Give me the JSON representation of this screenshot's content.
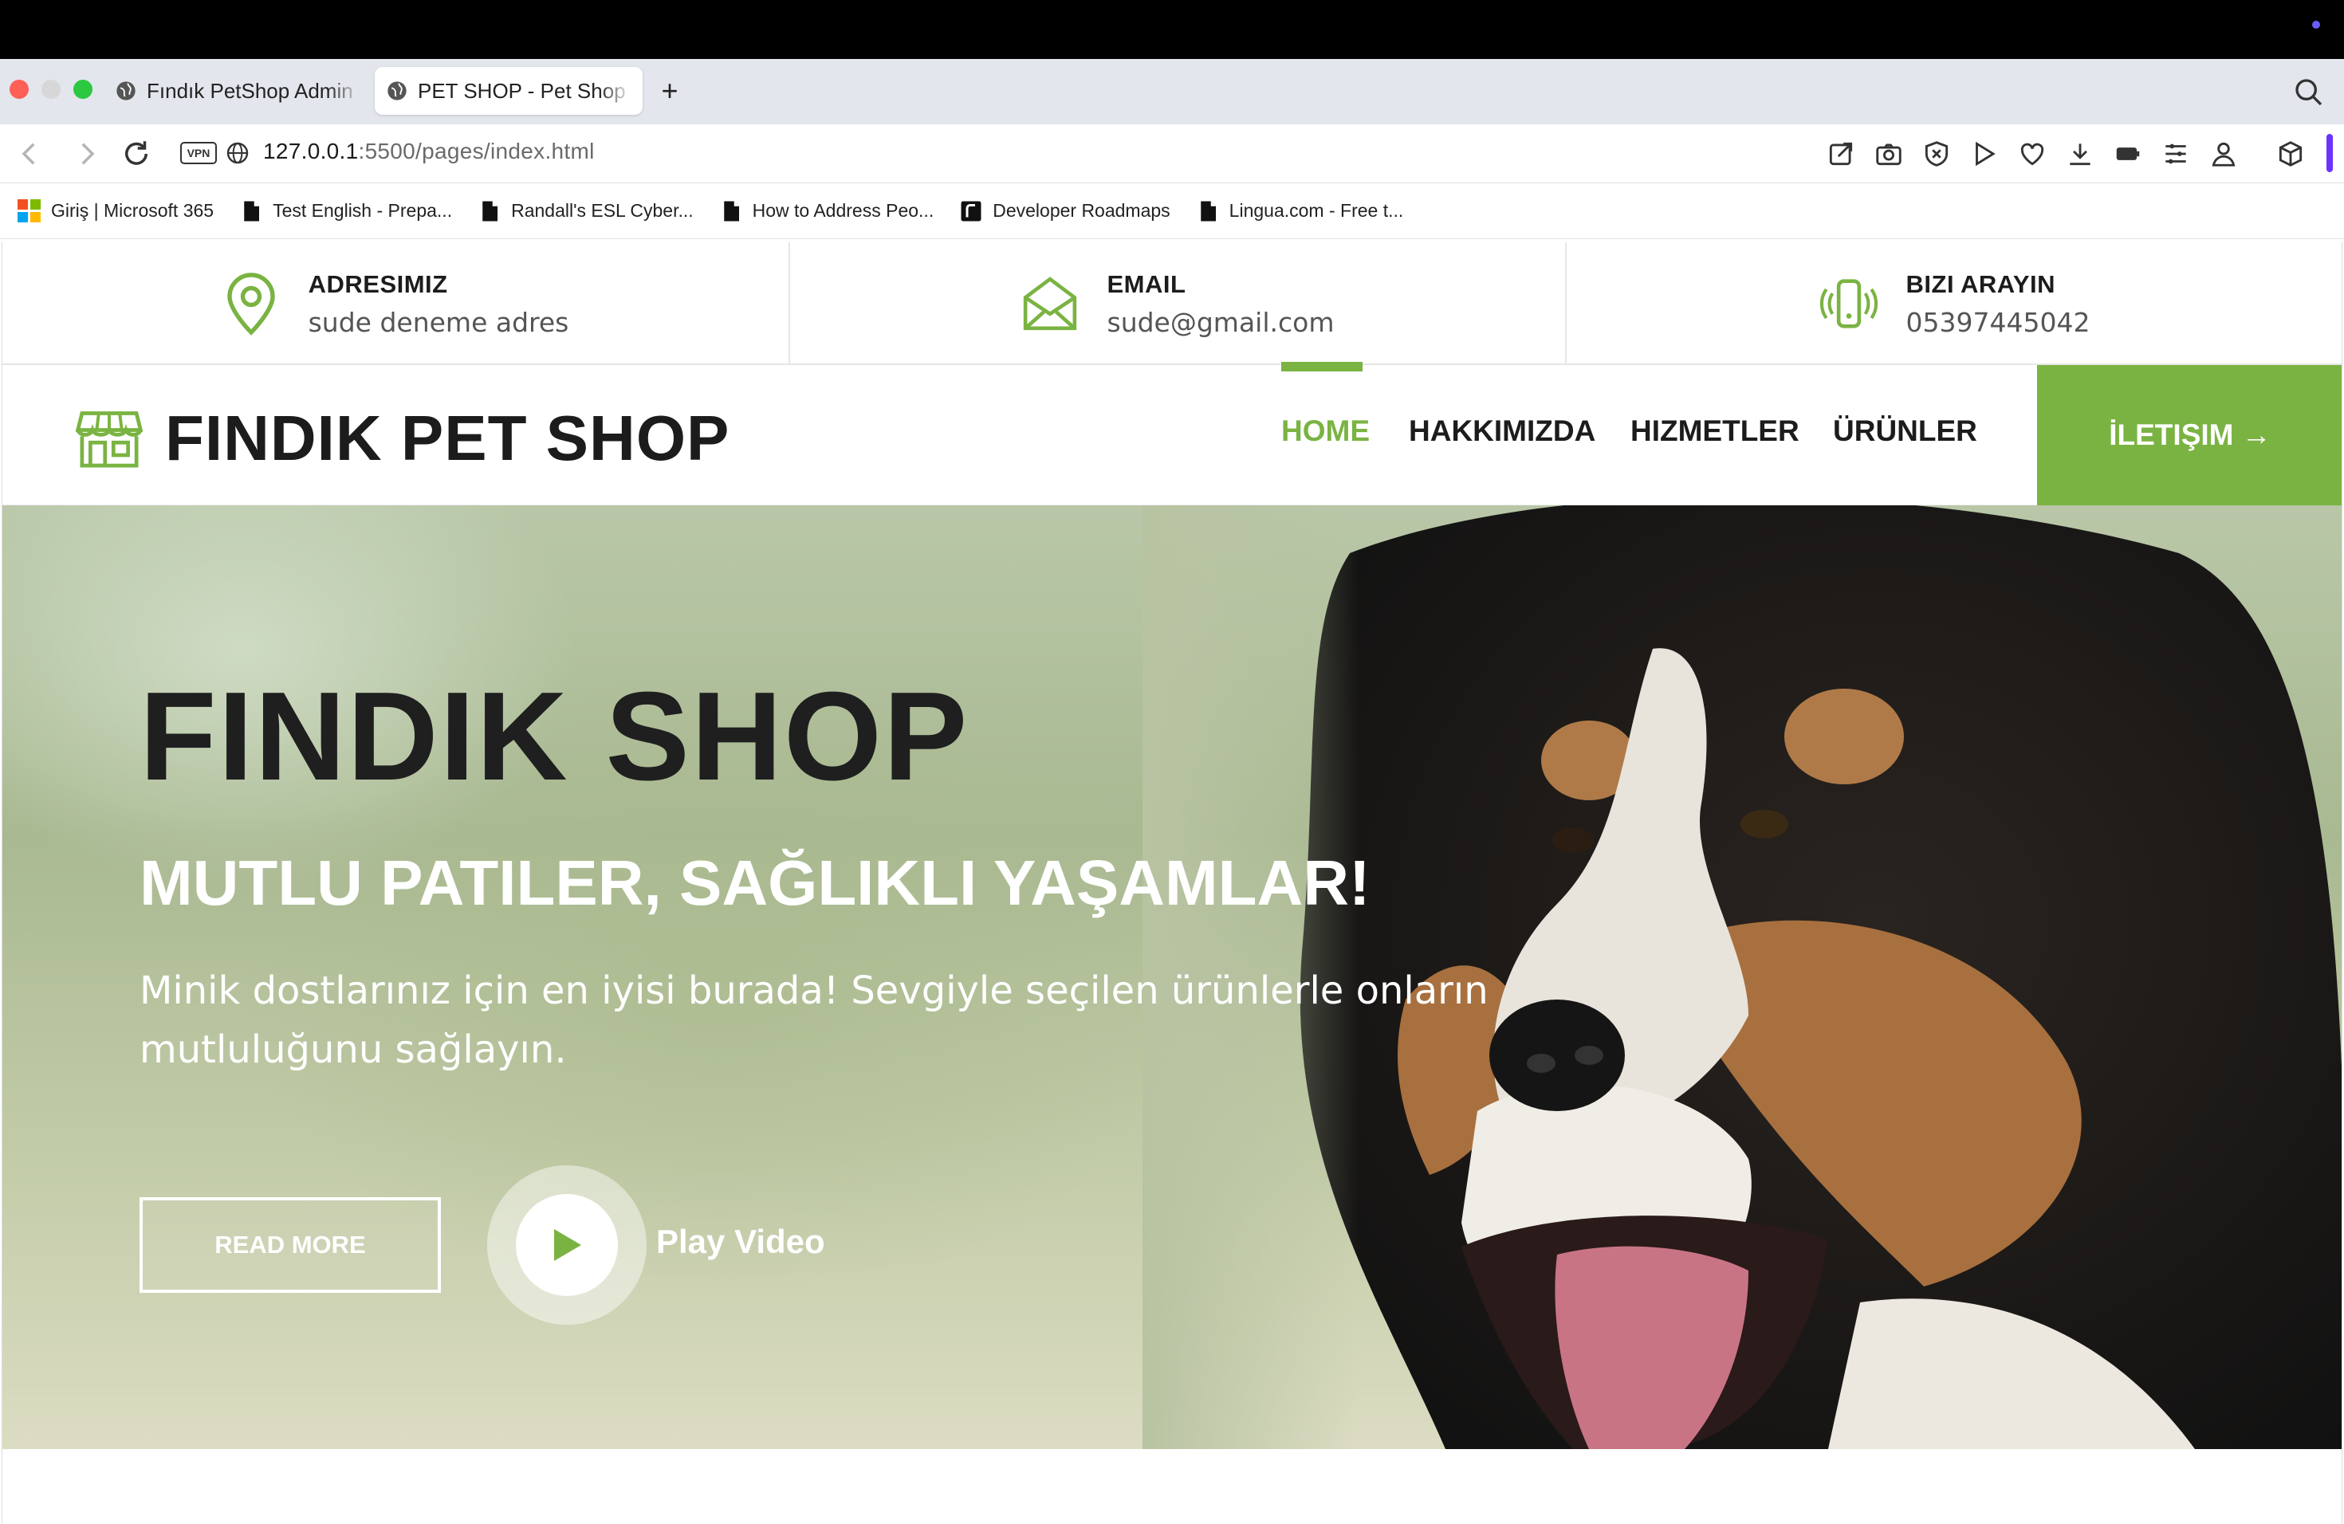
{
  "browser": {
    "tabs": [
      {
        "label": "Fındık PetShop Admin Pa",
        "active": false
      },
      {
        "label": "PET SHOP - Pet Shop W",
        "active": true
      }
    ],
    "new_tab_symbol": "+",
    "url_host": "127.0.0.1",
    "url_rest": ":5500/pages/index.html",
    "vpn_label": "VPN",
    "toolbar_icons": [
      "share-icon",
      "camera-icon",
      "shield-icon",
      "play-icon",
      "heart-icon",
      "download-icon",
      "battery-icon",
      "menu-icon",
      "profile-icon",
      "extensions-icon"
    ],
    "bookmarks": [
      {
        "label": "Giriş | Microsoft 365",
        "icon": "microsoft-icon"
      },
      {
        "label": "Test English - Prepa...",
        "icon": "document-icon"
      },
      {
        "label": "Randall's ESL Cyber...",
        "icon": "document-icon"
      },
      {
        "label": "How to Address Peo...",
        "icon": "document-icon"
      },
      {
        "label": "Developer Roadmaps",
        "icon": "roadmap-icon"
      },
      {
        "label": "Lingua.com - Free t...",
        "icon": "document-icon"
      }
    ]
  },
  "contact": {
    "address": {
      "title": "ADRESIMIZ",
      "value": "sude deneme adres",
      "icon": "map-pin-icon"
    },
    "email": {
      "title": "EMAIL",
      "value": "sude@gmail.com",
      "icon": "envelope-icon"
    },
    "phone": {
      "title": "BIZI ARAYIN",
      "value": "05397445042",
      "icon": "phone-vibrate-icon"
    }
  },
  "nav": {
    "brand": "FINDIK PET SHOP",
    "brand_icon": "store-icon",
    "items": [
      {
        "label": "HOME",
        "active": true
      },
      {
        "label": "HAKKIMIZDA",
        "active": false
      },
      {
        "label": "HIZMETLER",
        "active": false
      },
      {
        "label": "ÜRÜNLER",
        "active": false
      }
    ],
    "cta": "İLETIŞIM →"
  },
  "hero": {
    "title": "FINDIK SHOP",
    "subtitle": "MUTLU PATILER, SAĞLIKLI YAŞAMLAR!",
    "description": "Minik dostlarınız için en iyisi burada! Sevgiyle seçilen ürünlerle onların mutluluğunu sağlayın.",
    "read_more": "READ MORE",
    "play_video": "Play Video"
  },
  "colors": {
    "accent": "#7ab342",
    "dark_text": "#1c1c1c"
  }
}
